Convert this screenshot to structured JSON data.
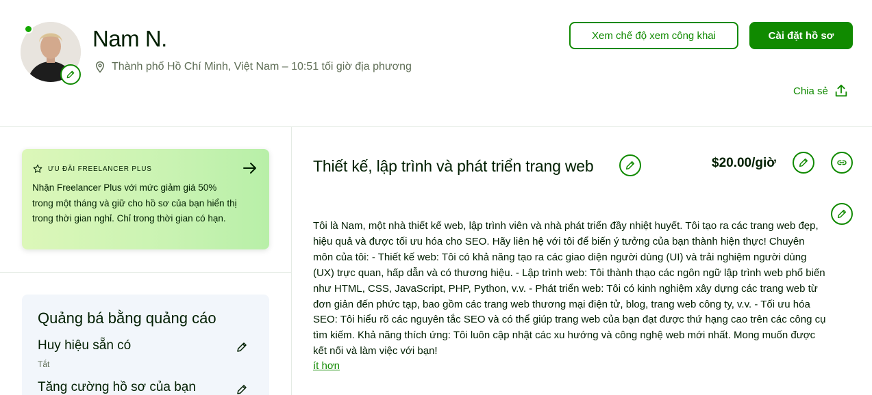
{
  "profile": {
    "name": "Nam N.",
    "location": "Thành phố Hồ Chí Minh, Việt Nam – 10:51 tối giờ địa phương"
  },
  "header": {
    "public_view_label": "Xem chế độ xem công khai",
    "settings_label": "Cài đặt hồ sơ",
    "share_label": "Chia sẻ"
  },
  "promo": {
    "tag": "ƯU ĐÃI FREELANCER PLUS",
    "text": "Nhận Freelancer Plus với mức giảm giá 50% trong một tháng và giữ cho hồ sơ của bạn hiển thị trong thời gian nghỉ. Chỉ trong thời gian có hạn."
  },
  "ads": {
    "title": "Quảng bá bằng quảng cáo",
    "badge_label": "Huy hiệu sẵn có",
    "badge_value": "Tắt",
    "boost_label": "Tăng cường hồ sơ của bạn"
  },
  "main": {
    "title": "Thiết kế, lập trình và phát triển trang web",
    "rate": "$20.00/giờ",
    "description": "Tôi là Nam, một nhà thiết kế web, lập trình viên và nhà phát triển đầy nhiệt huyết. Tôi tạo ra các trang web đẹp, hiệu quả và được tối ưu hóa cho SEO. Hãy liên hệ với tôi để biến ý tưởng của bạn thành hiện thực! Chuyên môn của tôi: - Thiết kế web: Tôi có khả năng tạo ra các giao diện người dùng (UI) và trải nghiệm người dùng (UX) trực quan, hấp dẫn và có thương hiệu. - Lập trình web: Tôi thành thạo các ngôn ngữ lập trình web phổ biến như HTML, CSS, JavaScript, PHP, Python, v.v. - Phát triển web: Tôi có kinh nghiệm xây dựng các trang web từ đơn giản đến phức tạp, bao gồm các trang web thương mại điện tử, blog, trang web công ty, v.v. - Tối ưu hóa SEO: Tôi hiểu rõ các nguyên tắc SEO và có thể giúp trang web của bạn đạt được thứ hạng cao trên các công cụ tìm kiếm. Khả năng thích ứng: Tôi luôn cập nhật các xu hướng và công nghệ web mới nhất. Mong muốn được kết nối và làm việc với bạn!",
    "more_label": "ít hơn"
  },
  "colors": {
    "brand_green": "#108a00",
    "text_dark": "#001e00",
    "muted": "#5e6d55"
  },
  "icons": [
    "pencil-icon",
    "location-pin-icon",
    "share-icon",
    "star-icon",
    "arrow-right-icon",
    "link-icon"
  ]
}
